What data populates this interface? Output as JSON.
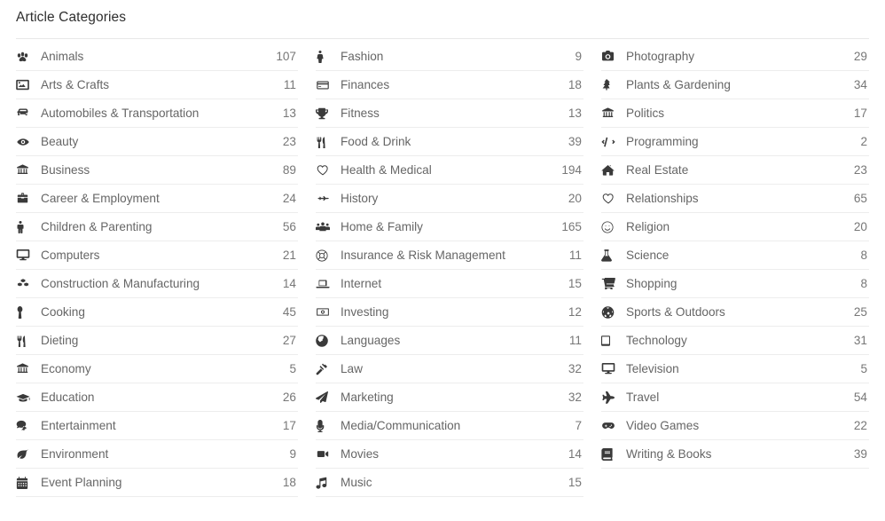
{
  "header": {
    "title": "Article Categories"
  },
  "colors": {
    "page_background": "#ffffff",
    "title_text": "#2f2f2f",
    "label_text": "#666666",
    "count_text": "#777777",
    "icon": "#3a3a3a",
    "divider": "#ededed",
    "header_divider": "#e8e8e8"
  },
  "columns": [
    {
      "id": "column-1",
      "items": [
        {
          "label": "Animals",
          "count": "107",
          "icon": "paw-icon"
        },
        {
          "label": "Arts & Crafts",
          "count": "11",
          "icon": "image-icon"
        },
        {
          "label": "Automobiles & Transportation",
          "count": "13",
          "icon": "car-icon"
        },
        {
          "label": "Beauty",
          "count": "23",
          "icon": "eye-icon"
        },
        {
          "label": "Business",
          "count": "89",
          "icon": "bank-icon"
        },
        {
          "label": "Career & Employment",
          "count": "24",
          "icon": "briefcase-icon"
        },
        {
          "label": "Children & Parenting",
          "count": "56",
          "icon": "child-icon"
        },
        {
          "label": "Computers",
          "count": "21",
          "icon": "desktop-icon"
        },
        {
          "label": "Construction & Manufacturing",
          "count": "14",
          "icon": "cubes-icon"
        },
        {
          "label": "Cooking",
          "count": "45",
          "icon": "spoon-icon"
        },
        {
          "label": "Dieting",
          "count": "27",
          "icon": "cutlery-icon"
        },
        {
          "label": "Economy",
          "count": "5",
          "icon": "bank-icon"
        },
        {
          "label": "Education",
          "count": "26",
          "icon": "graduation-cap-icon"
        },
        {
          "label": "Entertainment",
          "count": "17",
          "icon": "comments-icon"
        },
        {
          "label": "Environment",
          "count": "9",
          "icon": "leaf-icon"
        },
        {
          "label": "Event Planning",
          "count": "18",
          "icon": "calendar-icon"
        }
      ]
    },
    {
      "id": "column-2",
      "items": [
        {
          "label": "Fashion",
          "count": "9",
          "icon": "female-icon"
        },
        {
          "label": "Finances",
          "count": "18",
          "icon": "credit-card-icon"
        },
        {
          "label": "Fitness",
          "count": "13",
          "icon": "trophy-icon"
        },
        {
          "label": "Food & Drink",
          "count": "39",
          "icon": "cutlery-icon"
        },
        {
          "label": "Health & Medical",
          "count": "194",
          "icon": "heart-outline-icon"
        },
        {
          "label": "History",
          "count": "20",
          "icon": "fighter-jet-icon"
        },
        {
          "label": "Home & Family",
          "count": "165",
          "icon": "group-icon"
        },
        {
          "label": "Insurance & Risk Management",
          "count": "11",
          "icon": "life-ring-icon"
        },
        {
          "label": "Internet",
          "count": "15",
          "icon": "laptop-icon"
        },
        {
          "label": "Investing",
          "count": "12",
          "icon": "money-bill-icon"
        },
        {
          "label": "Languages",
          "count": "11",
          "icon": "globe-icon"
        },
        {
          "label": "Law",
          "count": "32",
          "icon": "gavel-icon"
        },
        {
          "label": "Marketing",
          "count": "32",
          "icon": "paper-plane-icon"
        },
        {
          "label": "Media/Communication",
          "count": "7",
          "icon": "microphone-icon"
        },
        {
          "label": "Movies",
          "count": "14",
          "icon": "video-camera-icon"
        },
        {
          "label": "Music",
          "count": "15",
          "icon": "music-note-icon"
        }
      ]
    },
    {
      "id": "column-3",
      "items": [
        {
          "label": "Photography",
          "count": "29",
          "icon": "camera-icon"
        },
        {
          "label": "Plants & Gardening",
          "count": "34",
          "icon": "tree-icon"
        },
        {
          "label": "Politics",
          "count": "17",
          "icon": "bank-icon"
        },
        {
          "label": "Programming",
          "count": "2",
          "icon": "code-icon"
        },
        {
          "label": "Real Estate",
          "count": "23",
          "icon": "home-icon"
        },
        {
          "label": "Relationships",
          "count": "65",
          "icon": "heart-outline-icon"
        },
        {
          "label": "Religion",
          "count": "20",
          "icon": "smile-icon"
        },
        {
          "label": "Science",
          "count": "8",
          "icon": "flask-icon"
        },
        {
          "label": "Shopping",
          "count": "8",
          "icon": "shopping-cart-icon"
        },
        {
          "label": "Sports & Outdoors",
          "count": "25",
          "icon": "futbol-icon"
        },
        {
          "label": "Technology",
          "count": "31",
          "icon": "tablet-icon"
        },
        {
          "label": "Television",
          "count": "5",
          "icon": "desktop-icon"
        },
        {
          "label": "Travel",
          "count": "54",
          "icon": "plane-icon"
        },
        {
          "label": "Video Games",
          "count": "22",
          "icon": "gamepad-icon"
        },
        {
          "label": "Writing & Books",
          "count": "39",
          "icon": "book-icon"
        }
      ]
    }
  ]
}
